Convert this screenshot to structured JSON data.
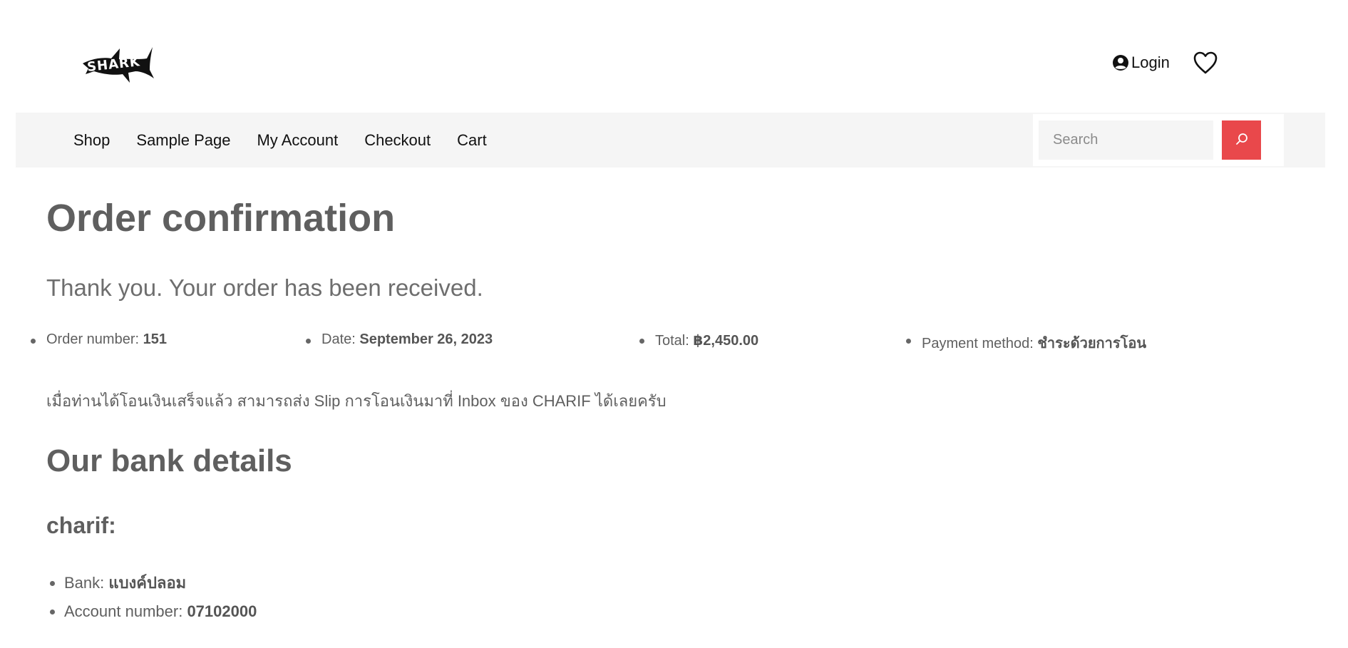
{
  "header": {
    "logo_text": "SHARK",
    "login_label": "Login"
  },
  "nav": {
    "items": [
      "Shop",
      "Sample Page",
      "My Account",
      "Checkout",
      "Cart"
    ],
    "search_placeholder": "Search"
  },
  "page": {
    "title": "Order confirmation",
    "thank_you": "Thank you. Your order has been received."
  },
  "order": {
    "number_label": "Order number:",
    "number": "151",
    "date_label": "Date:",
    "date": "September 26, 2023",
    "total_label": "Total:",
    "total": "฿2,450.00",
    "payment_label": "Payment method:",
    "payment": "ชำระด้วยการโอน"
  },
  "instructions": "เมื่อท่านได้โอนเงินเสร็จแล้ว สามารถส่ง Slip การโอนเงินมาที่ Inbox ของ CHARIF ได้เลยครับ",
  "bank": {
    "title": "Our bank details",
    "account_name": "charif:",
    "bank_label": "Bank:",
    "bank_name": "แบงค์ปลอม",
    "account_number_label": "Account number:",
    "account_number": "07102000"
  },
  "colors": {
    "accent": "#e9484b",
    "nav_background": "#f5f5f5",
    "text": "#5f5f5f"
  },
  "icons": [
    "shark-logo",
    "user-circle-icon",
    "heart-icon",
    "search-icon"
  ]
}
